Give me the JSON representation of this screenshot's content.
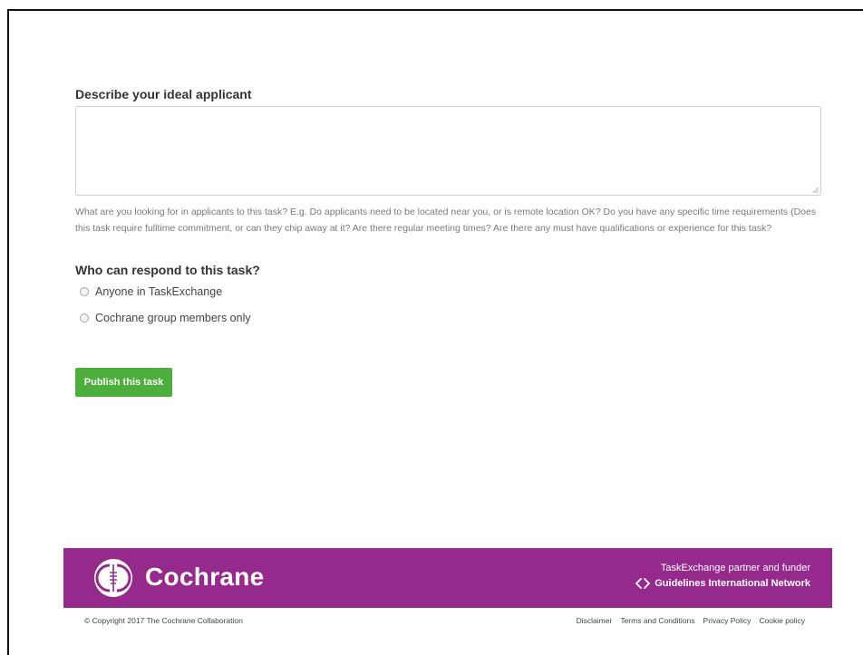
{
  "form": {
    "describe_label": "Describe your ideal applicant",
    "describe_value": "",
    "describe_help": "What are you looking for in applicants to this task? E.g. Do applicants need to be located near you, or is remote location OK? Do you have any specific time requirements (Does this task require fulltime commitment, or can they chip away at it? Are there regular meeting times? Are there any must have qualifications or experience for this task?",
    "respond_label": "Who can respond to this task?",
    "options": [
      {
        "label": "Anyone in TaskExchange",
        "selected": false
      },
      {
        "label": "Cochrane group members only",
        "selected": false
      }
    ],
    "publish_label": "Publish this task"
  },
  "footer": {
    "brand": "Cochrane",
    "partner_label": "TaskExchange partner and funder",
    "partner_org": "Guidelines International Network",
    "copyright": "© Copyright 2017 The Cochrane Collaboration",
    "links": [
      "Disclaimer",
      "Terms and Conditions",
      "Privacy Policy",
      "Cookie policy"
    ]
  },
  "colors": {
    "brand_purple": "#962a8c",
    "button_green": "#4caf3b"
  },
  "icons": {
    "logo": "cochrane-logo-icon",
    "partner": "gin-logo-icon",
    "resize": "resize-grip-icon"
  }
}
